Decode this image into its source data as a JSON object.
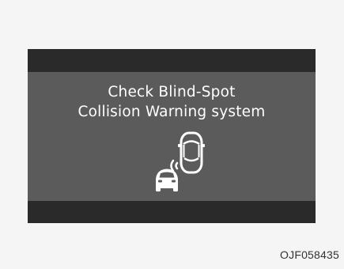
{
  "display": {
    "message_line_1": "Check Blind-Spot",
    "message_line_2": "Collision Warning system",
    "icon": "blind-spot-collision-warning-icon"
  },
  "caption": "OJF058435",
  "colors": {
    "screen_background": "#5b5b5b",
    "screen_bars": "#2a2a2a",
    "text": "#ffffff",
    "page_background": "#f5f5f5"
  }
}
